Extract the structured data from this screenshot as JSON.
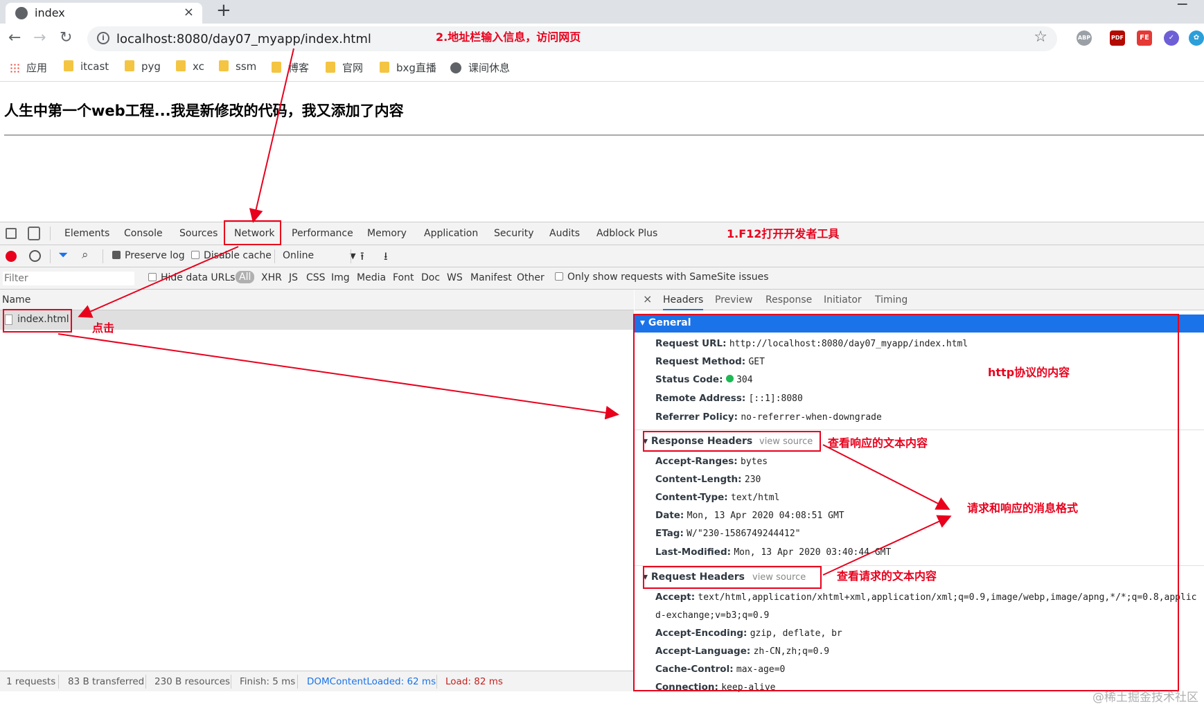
{
  "browser": {
    "tab_title": "index",
    "tab_close": "×",
    "new_tab": "+",
    "minimize": "−",
    "url": "localhost:8080/day07_myapp/index.html",
    "extensions": [
      "ABP",
      "PDF",
      "FE"
    ]
  },
  "bookmarks": [
    {
      "label": "应用",
      "icon": "apps-grid-icon"
    },
    {
      "label": "itcast",
      "icon": "folder-icon"
    },
    {
      "label": "pyg",
      "icon": "folder-icon"
    },
    {
      "label": "xc",
      "icon": "folder-icon"
    },
    {
      "label": "ssm",
      "icon": "folder-icon"
    },
    {
      "label": "博客",
      "icon": "folder-icon"
    },
    {
      "label": "官网",
      "icon": "folder-icon"
    },
    {
      "label": "bxg直播",
      "icon": "folder-icon"
    },
    {
      "label": "课间休息",
      "icon": "globe-icon"
    }
  ],
  "page": {
    "heading": "人生中第一个web工程...我是新修改的代码，我又添加了内容"
  },
  "devtools": {
    "tabs": [
      "Elements",
      "Console",
      "Sources",
      "Network",
      "Performance",
      "Memory",
      "Application",
      "Security",
      "Audits",
      "Adblock Plus"
    ],
    "active_tab": "Network",
    "toolbar": {
      "preserve_log": "Preserve log",
      "disable_cache": "Disable cache",
      "throttle": "Online"
    },
    "filter": {
      "placeholder": "Filter",
      "hide_data_urls": "Hide data URLs",
      "types": [
        "All",
        "XHR",
        "JS",
        "CSS",
        "Img",
        "Media",
        "Font",
        "Doc",
        "WS",
        "Manifest",
        "Other"
      ],
      "samesite": "Only show requests with SameSite issues"
    },
    "list": {
      "name_header": "Name",
      "request": "index.html"
    },
    "detail_tabs": [
      "Headers",
      "Preview",
      "Response",
      "Initiator",
      "Timing"
    ],
    "general": {
      "title": "General",
      "rows": [
        {
          "k": "Request URL:",
          "v": "http://localhost:8080/day07_myapp/index.html"
        },
        {
          "k": "Request Method:",
          "v": "GET"
        },
        {
          "k": "Status Code:",
          "v": "304"
        },
        {
          "k": "Remote Address:",
          "v": "[::1]:8080"
        },
        {
          "k": "Referrer Policy:",
          "v": "no-referrer-when-downgrade"
        }
      ],
      "status_color": "#1db954"
    },
    "response_headers": {
      "title": "Response Headers",
      "view_source": "view source",
      "rows": [
        {
          "k": "Accept-Ranges:",
          "v": "bytes"
        },
        {
          "k": "Content-Length:",
          "v": "230"
        },
        {
          "k": "Content-Type:",
          "v": "text/html"
        },
        {
          "k": "Date:",
          "v": "Mon, 13 Apr 2020 04:08:51 GMT"
        },
        {
          "k": "ETag:",
          "v": "W/\"230-1586749244412\""
        },
        {
          "k": "Last-Modified:",
          "v": "Mon, 13 Apr 2020 03:40:44 GMT"
        }
      ]
    },
    "request_headers": {
      "title": "Request Headers",
      "view_source": "view source",
      "rows": [
        {
          "k": "Accept:",
          "v": "text/html,application/xhtml+xml,application/xml;q=0.9,image/webp,image/apng,*/*;q=0.8,applic"
        },
        {
          "k": "",
          "v": "d-exchange;v=b3;q=0.9"
        },
        {
          "k": "Accept-Encoding:",
          "v": "gzip, deflate, br"
        },
        {
          "k": "Accept-Language:",
          "v": "zh-CN,zh;q=0.9"
        },
        {
          "k": "Cache-Control:",
          "v": "max-age=0"
        },
        {
          "k": "Connection:",
          "v": "keep-alive"
        }
      ]
    },
    "status": {
      "requests": "1 requests",
      "transferred": "83 B transferred",
      "resources": "230 B resources",
      "finish": "Finish: 5 ms",
      "dcl": "DOMContentLoaded: 62 ms",
      "load": "Load: 82 ms"
    }
  },
  "annotations": {
    "address_bar": "2.地址栏输入信息，访问网页",
    "f12": "1.F12打开开发者工具",
    "click": "点击",
    "http_content": "http协议的内容",
    "view_response": "查看响应的文本内容",
    "message_format": "请求和响应的消息格式",
    "view_request": "查看请求的文本内容",
    "color": "#e8001c"
  },
  "watermark": "@稀土掘金技术社区"
}
